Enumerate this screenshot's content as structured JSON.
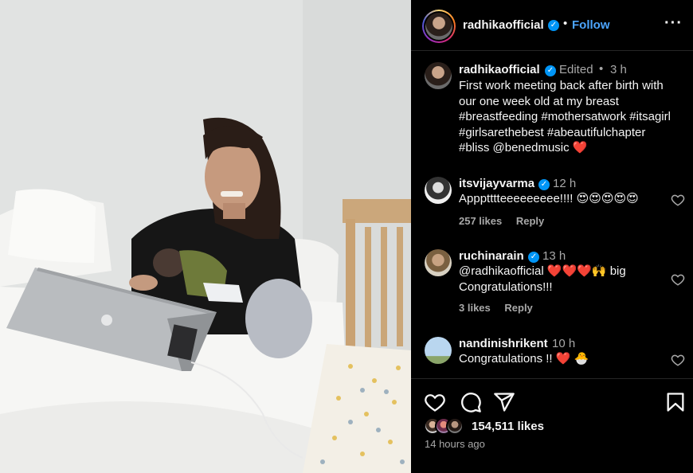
{
  "colors": {
    "accent": "#4ca5ff",
    "verified": "#0095f6",
    "heart": "#ed4956",
    "muted": "#a8a8a8"
  },
  "header": {
    "username": "radhikaofficial",
    "separator": "•",
    "follow_label": "Follow",
    "more_icon": "more-horizontal-icon"
  },
  "caption": {
    "username": "radhikaofficial",
    "edited": "Edited",
    "separator": "•",
    "time": "3 h",
    "lines": [
      "First work meeting back after birth with",
      "our one week old at my breast",
      "#breastfeeding #mothersatwork #itsagirl",
      "#girlsarethebest #abeautifulchapter",
      "#bliss @benedmusic ❤️"
    ]
  },
  "comments": [
    {
      "username": "itsvijayvarma",
      "time": "12 h",
      "text": [
        "Appptttteeeeeeeee!!!! 😍😍😍😍😍"
      ],
      "likes": "257 likes",
      "reply": "Reply"
    },
    {
      "username": "ruchinarain",
      "time": "13 h",
      "text": [
        "@radhikaofficial ❤️❤️❤️🙌 big",
        "Congratulations!!!"
      ],
      "likes": "3 likes",
      "reply": "Reply"
    },
    {
      "username": "nandinishrikent",
      "time": "10 h",
      "text": [
        "Congratulations !! ❤️ 🐣"
      ],
      "likes": "",
      "reply": ""
    }
  ],
  "footer": {
    "likes": "154,511 likes",
    "time_ago": "14 hours ago"
  }
}
